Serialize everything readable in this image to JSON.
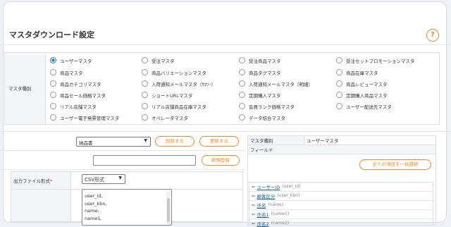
{
  "page": {
    "title": "マスタダウンロード設定",
    "help_glyph": "?"
  },
  "master_type": {
    "label": "マスタ種別",
    "options": [
      "ユーザーマスタ",
      "受注マスタ",
      "受注商品マスタ",
      "受注セットプロモーションマスタ",
      "商品マスタ",
      "商品バリエーションマスタ",
      "商品タグマスタ",
      "商品在庫マスタ",
      "商品カテゴリマスタ",
      "入荷通知メールマスタ（ｻﾏﾘｰ）",
      "入荷通知メールマスタ（明細）",
      "商品レビューマスタ",
      "商品セール価格マスタ",
      "ショートURLマスタ",
      "定期購入マスタ",
      "定期購入商品マスタ",
      "リアル店舗マスタ",
      "リアル店舗商品在庫マスタ",
      "会員ランク価格マスタ",
      "ユーザー配送先マスタ",
      "ユーザー電子発票管理マスタ",
      "オペレータマスタ",
      "データ結合マスタ"
    ],
    "selected": "ユーザーマスタ"
  },
  "template": {
    "selected": "納品書",
    "delete_label": "削除する",
    "update_label": "更新する",
    "new_name_value": "",
    "register_label": "新規登録"
  },
  "output": {
    "format_label": "出力ファイル形式",
    "required_mark": "*",
    "format_value": "CSV形式",
    "fields_text": [
      "user_id,",
      "user_kbn,",
      "name,",
      "name1,"
    ]
  },
  "right_panel": {
    "type_label": "マスタ種別",
    "type_value": "ユーザーマスタ",
    "field_label": "フィールド",
    "select_all_label": "全ての項目を一括選択",
    "fields": [
      {
        "name": "ユーザーID",
        "code": "(user_id)"
      },
      {
        "name": "顧客区分",
        "code": "(user_kbn)"
      },
      {
        "name": "氏名",
        "code": "(name)"
      },
      {
        "name": "氏名1",
        "code": "(name1)"
      },
      {
        "name": "氏名2",
        "code": "(name2)"
      }
    ],
    "arrow_glyph": "⇐"
  }
}
